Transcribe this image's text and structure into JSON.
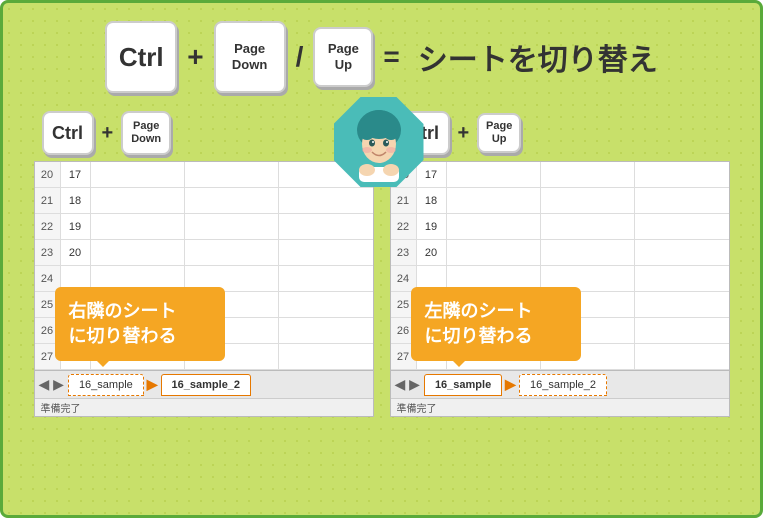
{
  "top": {
    "ctrl_label": "Ctrl",
    "plus1": "+",
    "pagedown_label": "Page\nDown",
    "slash": "/",
    "pageup_label": "Page\nUp",
    "equals": "=",
    "title": "シートを切り替え"
  },
  "left_panel": {
    "ctrl_label": "Ctrl",
    "plus": "+",
    "pagedown_label": "Page\nDown",
    "callout_text": "右隣のシートに切り替わる",
    "tabs": [
      "16_sample",
      "16_sample_2"
    ],
    "active_tab": "16_sample_2",
    "status": "準備完了"
  },
  "right_panel": {
    "ctrl_label": "Ctrl",
    "plus": "+",
    "pageup_label": "Page\nUp",
    "callout_text": "左隣のシートに切り替わる",
    "tabs": [
      "16_sample",
      "16_sample_2"
    ],
    "active_tab": "16_sample",
    "status": "準備完了"
  },
  "rows": [
    {
      "row": "20",
      "idx": "17"
    },
    {
      "row": "21",
      "idx": "18"
    },
    {
      "row": "22",
      "idx": "19"
    },
    {
      "row": "23",
      "idx": "20"
    },
    {
      "row": "24",
      "idx": ""
    },
    {
      "row": "25",
      "idx": ""
    },
    {
      "row": "26",
      "idx": ""
    },
    {
      "row": "27",
      "idx": ""
    }
  ]
}
